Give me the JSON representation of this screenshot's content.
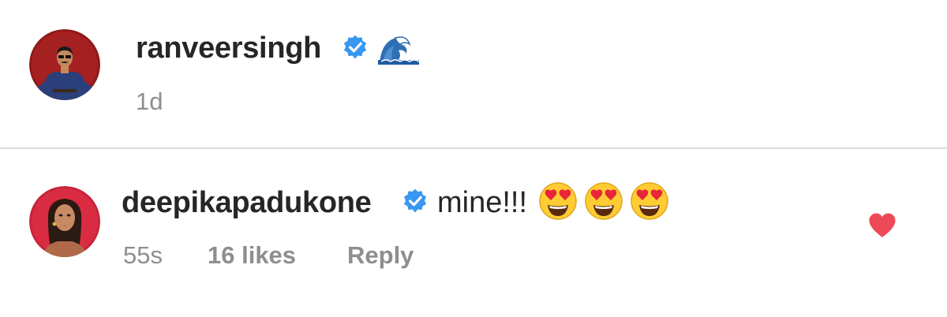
{
  "post": {
    "username": "ranveersingh",
    "verified": true,
    "caption_emoji": "🌊",
    "timestamp": "1d",
    "avatar_icon": "profile-photo-man-red-background"
  },
  "comment": {
    "username": "deepikapadukone",
    "verified": true,
    "text": "mine!!!",
    "emojis": [
      "😍",
      "😍",
      "😍"
    ],
    "timestamp": "55s",
    "likes": "16 likes",
    "reply_label": "Reply",
    "liked": true,
    "avatar_icon": "profile-photo-woman-red-background"
  },
  "colors": {
    "verified_badge": "#3897f0",
    "heart": "#ed4956",
    "meta_text": "#8e8e8e",
    "divider": "#dbdbdb"
  }
}
